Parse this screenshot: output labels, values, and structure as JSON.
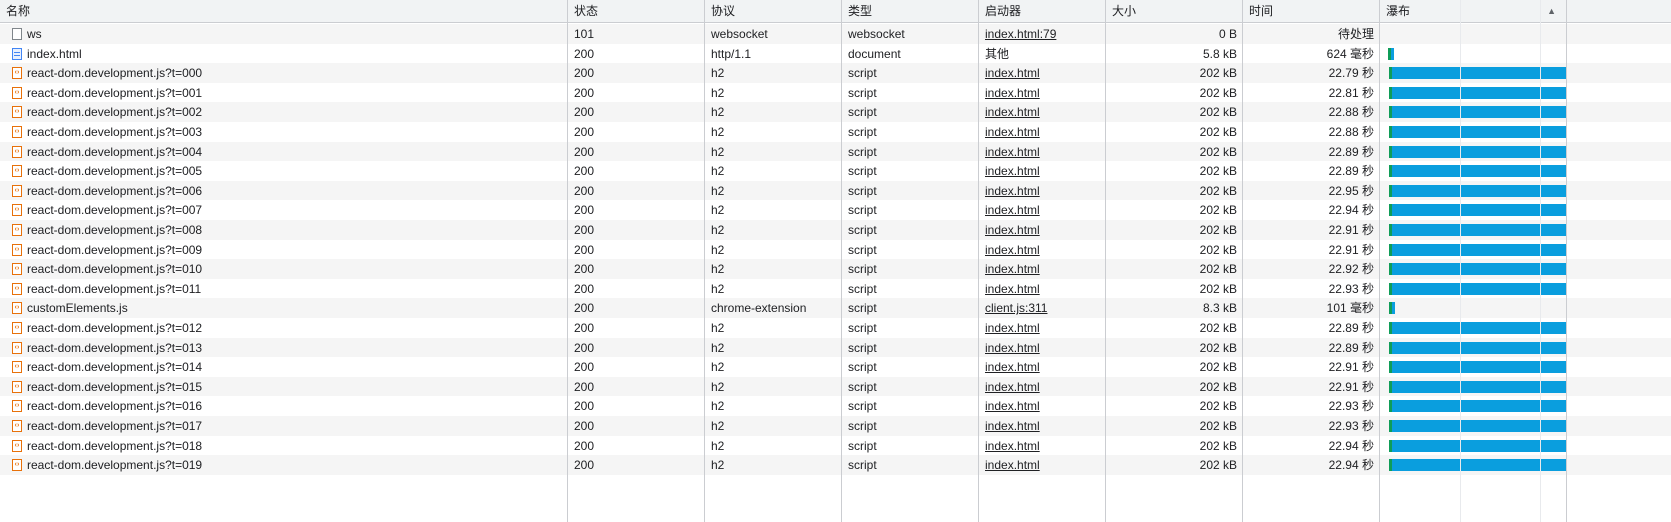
{
  "columns": [
    {
      "key": "name",
      "label": "名称"
    },
    {
      "key": "status",
      "label": "状态"
    },
    {
      "key": "protocol",
      "label": "协议"
    },
    {
      "key": "type",
      "label": "类型"
    },
    {
      "key": "initiator",
      "label": "启动器"
    },
    {
      "key": "size",
      "label": "大小"
    },
    {
      "key": "time",
      "label": "时间"
    },
    {
      "key": "waterfall",
      "label": "瀑布"
    }
  ],
  "sort_indicator": "▲",
  "colors": {
    "waiting": "#0f9d58",
    "download": "#0a9ede"
  },
  "rows": [
    {
      "icon": "ws",
      "name": "ws",
      "status": "101",
      "protocol": "websocket",
      "type": "websocket",
      "initiator": "index.html:79",
      "initiator_link": true,
      "size": "0 B",
      "time": "待处理",
      "wf": null
    },
    {
      "icon": "doc",
      "name": "index.html",
      "status": "200",
      "protocol": "http/1.1",
      "type": "document",
      "initiator": "其他",
      "initiator_link": false,
      "size": "5.8 kB",
      "time": "624 毫秒",
      "wf": {
        "start": 0.02,
        "wait": 0.01,
        "dl": 0.02
      }
    },
    {
      "icon": "script",
      "name": "react-dom.development.js?t=000",
      "status": "200",
      "protocol": "h2",
      "type": "script",
      "initiator": "index.html",
      "initiator_link": true,
      "size": "202 kB",
      "time": "22.79 秒",
      "wf": {
        "start": 0.04,
        "wait": 0.01,
        "dl": 0.95
      }
    },
    {
      "icon": "script",
      "name": "react-dom.development.js?t=001",
      "status": "200",
      "protocol": "h2",
      "type": "script",
      "initiator": "index.html",
      "initiator_link": true,
      "size": "202 kB",
      "time": "22.81 秒",
      "wf": {
        "start": 0.04,
        "wait": 0.01,
        "dl": 0.95
      }
    },
    {
      "icon": "script",
      "name": "react-dom.development.js?t=002",
      "status": "200",
      "protocol": "h2",
      "type": "script",
      "initiator": "index.html",
      "initiator_link": true,
      "size": "202 kB",
      "time": "22.88 秒",
      "wf": {
        "start": 0.04,
        "wait": 0.01,
        "dl": 0.95
      }
    },
    {
      "icon": "script",
      "name": "react-dom.development.js?t=003",
      "status": "200",
      "protocol": "h2",
      "type": "script",
      "initiator": "index.html",
      "initiator_link": true,
      "size": "202 kB",
      "time": "22.88 秒",
      "wf": {
        "start": 0.04,
        "wait": 0.01,
        "dl": 0.95
      }
    },
    {
      "icon": "script",
      "name": "react-dom.development.js?t=004",
      "status": "200",
      "protocol": "h2",
      "type": "script",
      "initiator": "index.html",
      "initiator_link": true,
      "size": "202 kB",
      "time": "22.89 秒",
      "wf": {
        "start": 0.04,
        "wait": 0.01,
        "dl": 0.95
      }
    },
    {
      "icon": "script",
      "name": "react-dom.development.js?t=005",
      "status": "200",
      "protocol": "h2",
      "type": "script",
      "initiator": "index.html",
      "initiator_link": true,
      "size": "202 kB",
      "time": "22.89 秒",
      "wf": {
        "start": 0.04,
        "wait": 0.01,
        "dl": 0.95
      }
    },
    {
      "icon": "script",
      "name": "react-dom.development.js?t=006",
      "status": "200",
      "protocol": "h2",
      "type": "script",
      "initiator": "index.html",
      "initiator_link": true,
      "size": "202 kB",
      "time": "22.95 秒",
      "wf": {
        "start": 0.04,
        "wait": 0.01,
        "dl": 0.95
      }
    },
    {
      "icon": "script",
      "name": "react-dom.development.js?t=007",
      "status": "200",
      "protocol": "h2",
      "type": "script",
      "initiator": "index.html",
      "initiator_link": true,
      "size": "202 kB",
      "time": "22.94 秒",
      "wf": {
        "start": 0.04,
        "wait": 0.01,
        "dl": 0.95
      }
    },
    {
      "icon": "script",
      "name": "react-dom.development.js?t=008",
      "status": "200",
      "protocol": "h2",
      "type": "script",
      "initiator": "index.html",
      "initiator_link": true,
      "size": "202 kB",
      "time": "22.91 秒",
      "wf": {
        "start": 0.04,
        "wait": 0.01,
        "dl": 0.95
      }
    },
    {
      "icon": "script",
      "name": "react-dom.development.js?t=009",
      "status": "200",
      "protocol": "h2",
      "type": "script",
      "initiator": "index.html",
      "initiator_link": true,
      "size": "202 kB",
      "time": "22.91 秒",
      "wf": {
        "start": 0.04,
        "wait": 0.01,
        "dl": 0.95
      }
    },
    {
      "icon": "script",
      "name": "react-dom.development.js?t=010",
      "status": "200",
      "protocol": "h2",
      "type": "script",
      "initiator": "index.html",
      "initiator_link": true,
      "size": "202 kB",
      "time": "22.92 秒",
      "wf": {
        "start": 0.04,
        "wait": 0.01,
        "dl": 0.95
      }
    },
    {
      "icon": "script",
      "name": "react-dom.development.js?t=011",
      "status": "200",
      "protocol": "h2",
      "type": "script",
      "initiator": "index.html",
      "initiator_link": true,
      "size": "202 kB",
      "time": "22.93 秒",
      "wf": {
        "start": 0.04,
        "wait": 0.01,
        "dl": 0.95
      }
    },
    {
      "icon": "script",
      "name": "customElements.js",
      "status": "200",
      "protocol": "chrome-extension",
      "type": "script",
      "initiator": "client.js:311",
      "initiator_link": true,
      "size": "8.3 kB",
      "time": "101 毫秒",
      "wf": {
        "start": 0.03,
        "wait": 0.0,
        "dl": 0.01
      }
    },
    {
      "icon": "script",
      "name": "react-dom.development.js?t=012",
      "status": "200",
      "protocol": "h2",
      "type": "script",
      "initiator": "index.html",
      "initiator_link": true,
      "size": "202 kB",
      "time": "22.89 秒",
      "wf": {
        "start": 0.04,
        "wait": 0.01,
        "dl": 0.95
      }
    },
    {
      "icon": "script",
      "name": "react-dom.development.js?t=013",
      "status": "200",
      "protocol": "h2",
      "type": "script",
      "initiator": "index.html",
      "initiator_link": true,
      "size": "202 kB",
      "time": "22.89 秒",
      "wf": {
        "start": 0.04,
        "wait": 0.01,
        "dl": 0.95
      }
    },
    {
      "icon": "script",
      "name": "react-dom.development.js?t=014",
      "status": "200",
      "protocol": "h2",
      "type": "script",
      "initiator": "index.html",
      "initiator_link": true,
      "size": "202 kB",
      "time": "22.91 秒",
      "wf": {
        "start": 0.04,
        "wait": 0.01,
        "dl": 0.95
      }
    },
    {
      "icon": "script",
      "name": "react-dom.development.js?t=015",
      "status": "200",
      "protocol": "h2",
      "type": "script",
      "initiator": "index.html",
      "initiator_link": true,
      "size": "202 kB",
      "time": "22.91 秒",
      "wf": {
        "start": 0.04,
        "wait": 0.01,
        "dl": 0.95
      }
    },
    {
      "icon": "script",
      "name": "react-dom.development.js?t=016",
      "status": "200",
      "protocol": "h2",
      "type": "script",
      "initiator": "index.html",
      "initiator_link": true,
      "size": "202 kB",
      "time": "22.93 秒",
      "wf": {
        "start": 0.04,
        "wait": 0.01,
        "dl": 0.95
      }
    },
    {
      "icon": "script",
      "name": "react-dom.development.js?t=017",
      "status": "200",
      "protocol": "h2",
      "type": "script",
      "initiator": "index.html",
      "initiator_link": true,
      "size": "202 kB",
      "time": "22.93 秒",
      "wf": {
        "start": 0.04,
        "wait": 0.01,
        "dl": 0.95
      }
    },
    {
      "icon": "script",
      "name": "react-dom.development.js?t=018",
      "status": "200",
      "protocol": "h2",
      "type": "script",
      "initiator": "index.html",
      "initiator_link": true,
      "size": "202 kB",
      "time": "22.94 秒",
      "wf": {
        "start": 0.04,
        "wait": 0.01,
        "dl": 0.95
      }
    },
    {
      "icon": "script",
      "name": "react-dom.development.js?t=019",
      "status": "200",
      "protocol": "h2",
      "type": "script",
      "initiator": "index.html",
      "initiator_link": true,
      "size": "202 kB",
      "time": "22.94 秒",
      "wf": {
        "start": 0.04,
        "wait": 0.01,
        "dl": 0.95
      }
    }
  ]
}
